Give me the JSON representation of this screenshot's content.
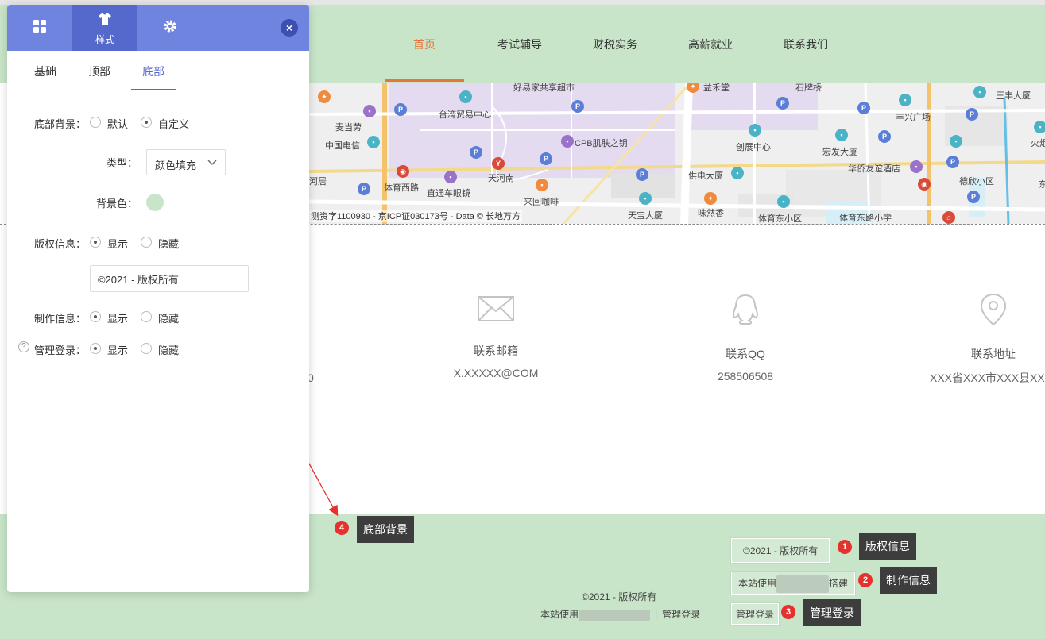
{
  "site": {
    "nav": [
      "首页",
      "考试辅导",
      "财税实务",
      "高薪就业",
      "联系我们"
    ],
    "map": {
      "labels": [
        "好易家共享超市",
        "益禾堂",
        "石牌桥",
        "王丰大厦",
        "台湾贸易中心",
        "丰兴广场",
        "麦当劳",
        "中国电信",
        "CPB肌肤之钥",
        "创展中心",
        "宏发大厦",
        "火炬",
        "河居",
        "体育西路",
        "天河南",
        "华侨友谊酒店",
        "德欣小区",
        "东",
        "直通车眼镜",
        "来回咖啡",
        "供电大厦",
        "味然香",
        "天宝大厦",
        "体育东小区",
        "体育东路小学"
      ],
      "copyright": "测资字1100930 - 京ICP证030173号 - Data © 长地万方"
    },
    "contacts": [
      {
        "icon": "mail-icon",
        "title": "联系邮箱",
        "value": "X.XXXXX@COM"
      },
      {
        "icon": "qq-icon",
        "title": "联系QQ",
        "value": "258506508"
      },
      {
        "icon": "location-icon",
        "title": "联系地址",
        "value": "XXX省XXX市XXX县XXX"
      }
    ],
    "first_contact_fragment": "0",
    "footer": {
      "copyright": "©2021 - 版权所有",
      "made_by_prefix": "本站使用",
      "separator": "|",
      "admin_login": "管理登录"
    },
    "annotations": [
      {
        "num": "1",
        "chip": "©2021 - 版权所有",
        "tip": "版权信息"
      },
      {
        "num": "2",
        "chip_prefix": "本站使用",
        "chip_suffix": "搭建",
        "tip": "制作信息"
      },
      {
        "num": "3",
        "chip": "管理登录",
        "tip": "管理登录"
      },
      {
        "num": "4",
        "tip": "底部背景"
      }
    ],
    "colors": {
      "header_bg": "#c9e5c9",
      "footer_bg": "#c9e5c9",
      "nav_active": "#e8763a",
      "arrow": "#e5322d"
    }
  },
  "panel": {
    "tabs": [
      {
        "icon": "grid-icon",
        "label": ""
      },
      {
        "icon": "shirt-icon",
        "label": "样式"
      },
      {
        "icon": "gear-icon",
        "label": ""
      }
    ],
    "subtabs": [
      "基础",
      "顶部",
      "底部"
    ],
    "form": {
      "bg_label": "底部背景：",
      "bg_default": "默认",
      "bg_custom": "自定义",
      "type_label": "类型：",
      "type_value": "颜色填充",
      "color_label": "背景色：",
      "color_value": "#c9e5c9",
      "copyright_label": "版权信息：",
      "show": "显示",
      "hide": "隐藏",
      "copyright_input": "©2021 - 版权所有",
      "made_label": "制作信息：",
      "admin_label": "管理登录：",
      "help": "?"
    },
    "colors": {
      "tab_bar": "#6e84df",
      "tab_active": "#5568cc"
    }
  }
}
